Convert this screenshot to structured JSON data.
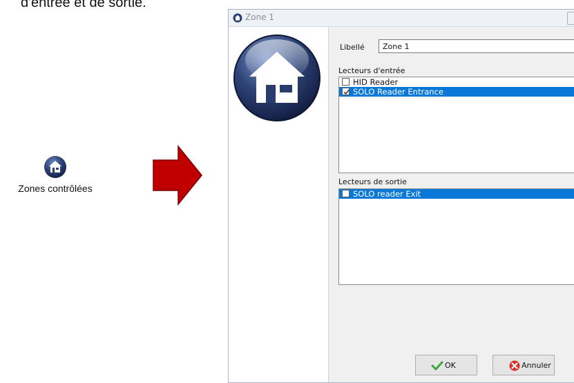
{
  "caption": "d'entrée et de sortie.",
  "launcher": {
    "icon": "home-icon",
    "label": "Zones contrôlées"
  },
  "dialog": {
    "title": "Zone 1",
    "name_label": "Libellé",
    "name_value": "Zone 1",
    "entry_label": "Lecteurs d'entrée",
    "entry_items": [
      {
        "label": "HID Reader",
        "checked": false,
        "selected": false
      },
      {
        "label": "SOLO Reader Entrance",
        "checked": true,
        "selected": true
      }
    ],
    "exit_label": "Lecteurs de sortie",
    "exit_items": [
      {
        "label": "SOLO reader Exit",
        "checked": false,
        "selected": true
      }
    ],
    "ok_label": "OK",
    "cancel_label": "Annuler",
    "colors": {
      "selection": "#0a78d7",
      "arrow": "#c00000"
    }
  }
}
